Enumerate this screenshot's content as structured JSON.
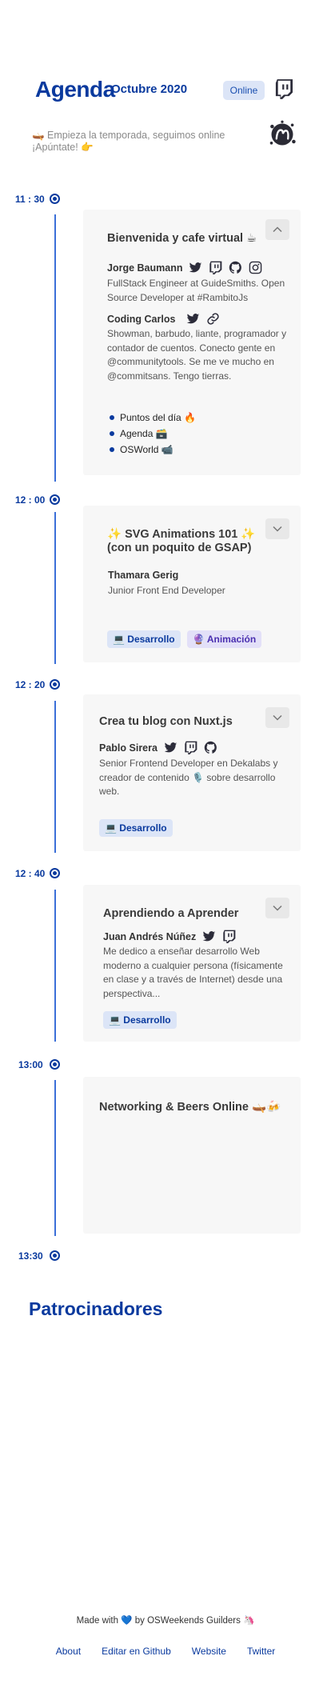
{
  "header": {
    "title": "Agenda",
    "month": "Octubre 2020",
    "badge": "Online",
    "intro": "🛶 Empieza la temporada, seguimos online ¡Apúntate! 👉"
  },
  "timeline": {
    "times": [
      "11 : 30",
      "12 : 00",
      "12 : 20",
      "12 : 40",
      "13:00",
      "13:30"
    ]
  },
  "talks": [
    {
      "title": "Bienvenida y cafe virtual ☕",
      "speakers": [
        {
          "name": "Jorge Baumann",
          "bio": "FullStack Engineer at GuideSmiths. Open Source Developer at #RambitoJs"
        },
        {
          "name": "Coding Carlos",
          "bio": "Showman, barbudo, liante, programador y contador de cuentos. Conecto gente en @communitytools. Se me ve mucho en @commitsans. Tengo tierras."
        }
      ],
      "links": [
        "Puntos del día 🔥",
        "Agenda 🗃️",
        "OSWorld 📹"
      ]
    },
    {
      "title_line1": "✨  SVG Animations 101  ✨",
      "title_line2": "(con un poquito de GSAP)",
      "speakers": [
        {
          "name": "Thamara Gerig",
          "bio": "Junior Front End Developer"
        }
      ],
      "tags": [
        "💻 Desarrollo",
        "🔮 Animación"
      ]
    },
    {
      "title": "Crea tu blog con Nuxt.js",
      "speakers": [
        {
          "name": "Pablo Sirera",
          "bio": "Senior Frontend Developer en Dekalabs y creador de contenido 🎙️ sobre desarrollo web."
        }
      ],
      "tags": [
        "💻 Desarrollo"
      ]
    },
    {
      "title": "Aprendiendo a Aprender",
      "speakers": [
        {
          "name": "Juan Andrés Núñez",
          "bio": "Me dedico a enseñar desarrollo Web moderno a cualquier persona (físicamente en clase y a través de Internet) desde una perspectiva..."
        }
      ],
      "tags": [
        "💻 Desarrollo"
      ]
    },
    {
      "title": "Networking & Beers Online 🛶🍻"
    }
  ],
  "sponsors_title": "Patrocinadores",
  "footer": {
    "made_pre": "Made with",
    "heart": "💙",
    "made_post": "by OSWeekends Guilders 🦄",
    "links": [
      "About",
      "Editar en Github",
      "Website",
      "Twitter"
    ]
  },
  "colors": {
    "brand": "#0a3a9e",
    "line": "#3b6fd8",
    "card": "#f7f7f7",
    "tag_bg": "#dce5f7"
  },
  "icons": [
    "twitter-icon",
    "twitch-icon",
    "github-icon",
    "instagram-icon",
    "link-icon",
    "chevron-up-icon",
    "chevron-down-icon"
  ]
}
